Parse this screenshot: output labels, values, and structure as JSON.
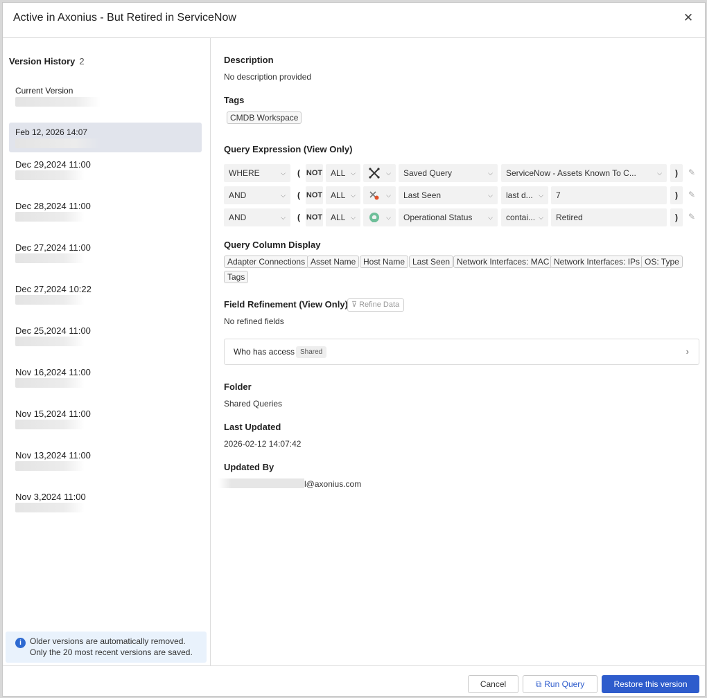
{
  "dialog": {
    "title": "Active in Axonius - But Retired in ServiceNow",
    "close_icon": "close-icon"
  },
  "version_history": {
    "title": "Version History",
    "count": "2",
    "items": [
      {
        "label": "Current Version"
      },
      {
        "label": "Feb 12, 2026 14:07"
      },
      {
        "label": "Dec 29,2024 11:00"
      },
      {
        "label": "Dec 28,2024 11:00"
      },
      {
        "label": "Dec 27,2024 11:00"
      },
      {
        "label": "Dec 27,2024 10:22"
      },
      {
        "label": "Dec 25,2024 11:00"
      },
      {
        "label": "Nov 16,2024 11:00"
      },
      {
        "label": "Nov 15,2024 11:00"
      },
      {
        "label": "Nov 13,2024 11:00"
      },
      {
        "label": "Nov 3,2024 11:00"
      }
    ],
    "info": "Older versions are automatically removed. Only the 20 most recent versions are saved."
  },
  "details": {
    "description_title": "Description",
    "description_value": "No description provided",
    "tags_title": "Tags",
    "tags": [
      "CMDB Workspace"
    ],
    "query_title": "Query Expression (View Only)",
    "rows": [
      {
        "op": "WHERE",
        "paren_open": "(",
        "not": "NOT",
        "all": "ALL",
        "field": "Saved Query",
        "cond": "ServiceNow - Assets Known To C...",
        "value": "",
        "paren_close": ")"
      },
      {
        "op": "AND",
        "paren_open": "(",
        "not": "NOT",
        "all": "ALL",
        "field": "Last Seen",
        "cond": "last d...",
        "value": "7",
        "paren_close": ")"
      },
      {
        "op": "AND",
        "paren_open": "(",
        "not": "NOT",
        "all": "ALL",
        "field": "Operational Status",
        "cond": "contai...",
        "value": "Retired",
        "paren_close": ")"
      }
    ],
    "column_title": "Query Column Display",
    "columns": [
      "Adapter Connections",
      "Asset Name",
      "Host Name",
      "Last Seen",
      "Network Interfaces: MAC",
      "Network Interfaces: IPs",
      "OS: Type",
      "Tags"
    ],
    "refinement_title": "Field Refinement (View Only)",
    "refine_button": "Refine Data",
    "refinement_value": "No refined fields",
    "access_label": "Who has access",
    "access_badge": "Shared",
    "folder_title": "Folder",
    "folder_value": "Shared Queries",
    "updated_title": "Last Updated",
    "updated_value": "2026-02-12 14:07:42",
    "updated_by_title": "Updated By",
    "updated_by_value": "l@axonius.com"
  },
  "footer": {
    "cancel": "Cancel",
    "run": "Run Query",
    "restore": "Restore this version"
  },
  "colors": {
    "primary": "#2e5ccc",
    "selected_bg": "#e1e4ec",
    "info_bg": "#e9f2fc"
  }
}
